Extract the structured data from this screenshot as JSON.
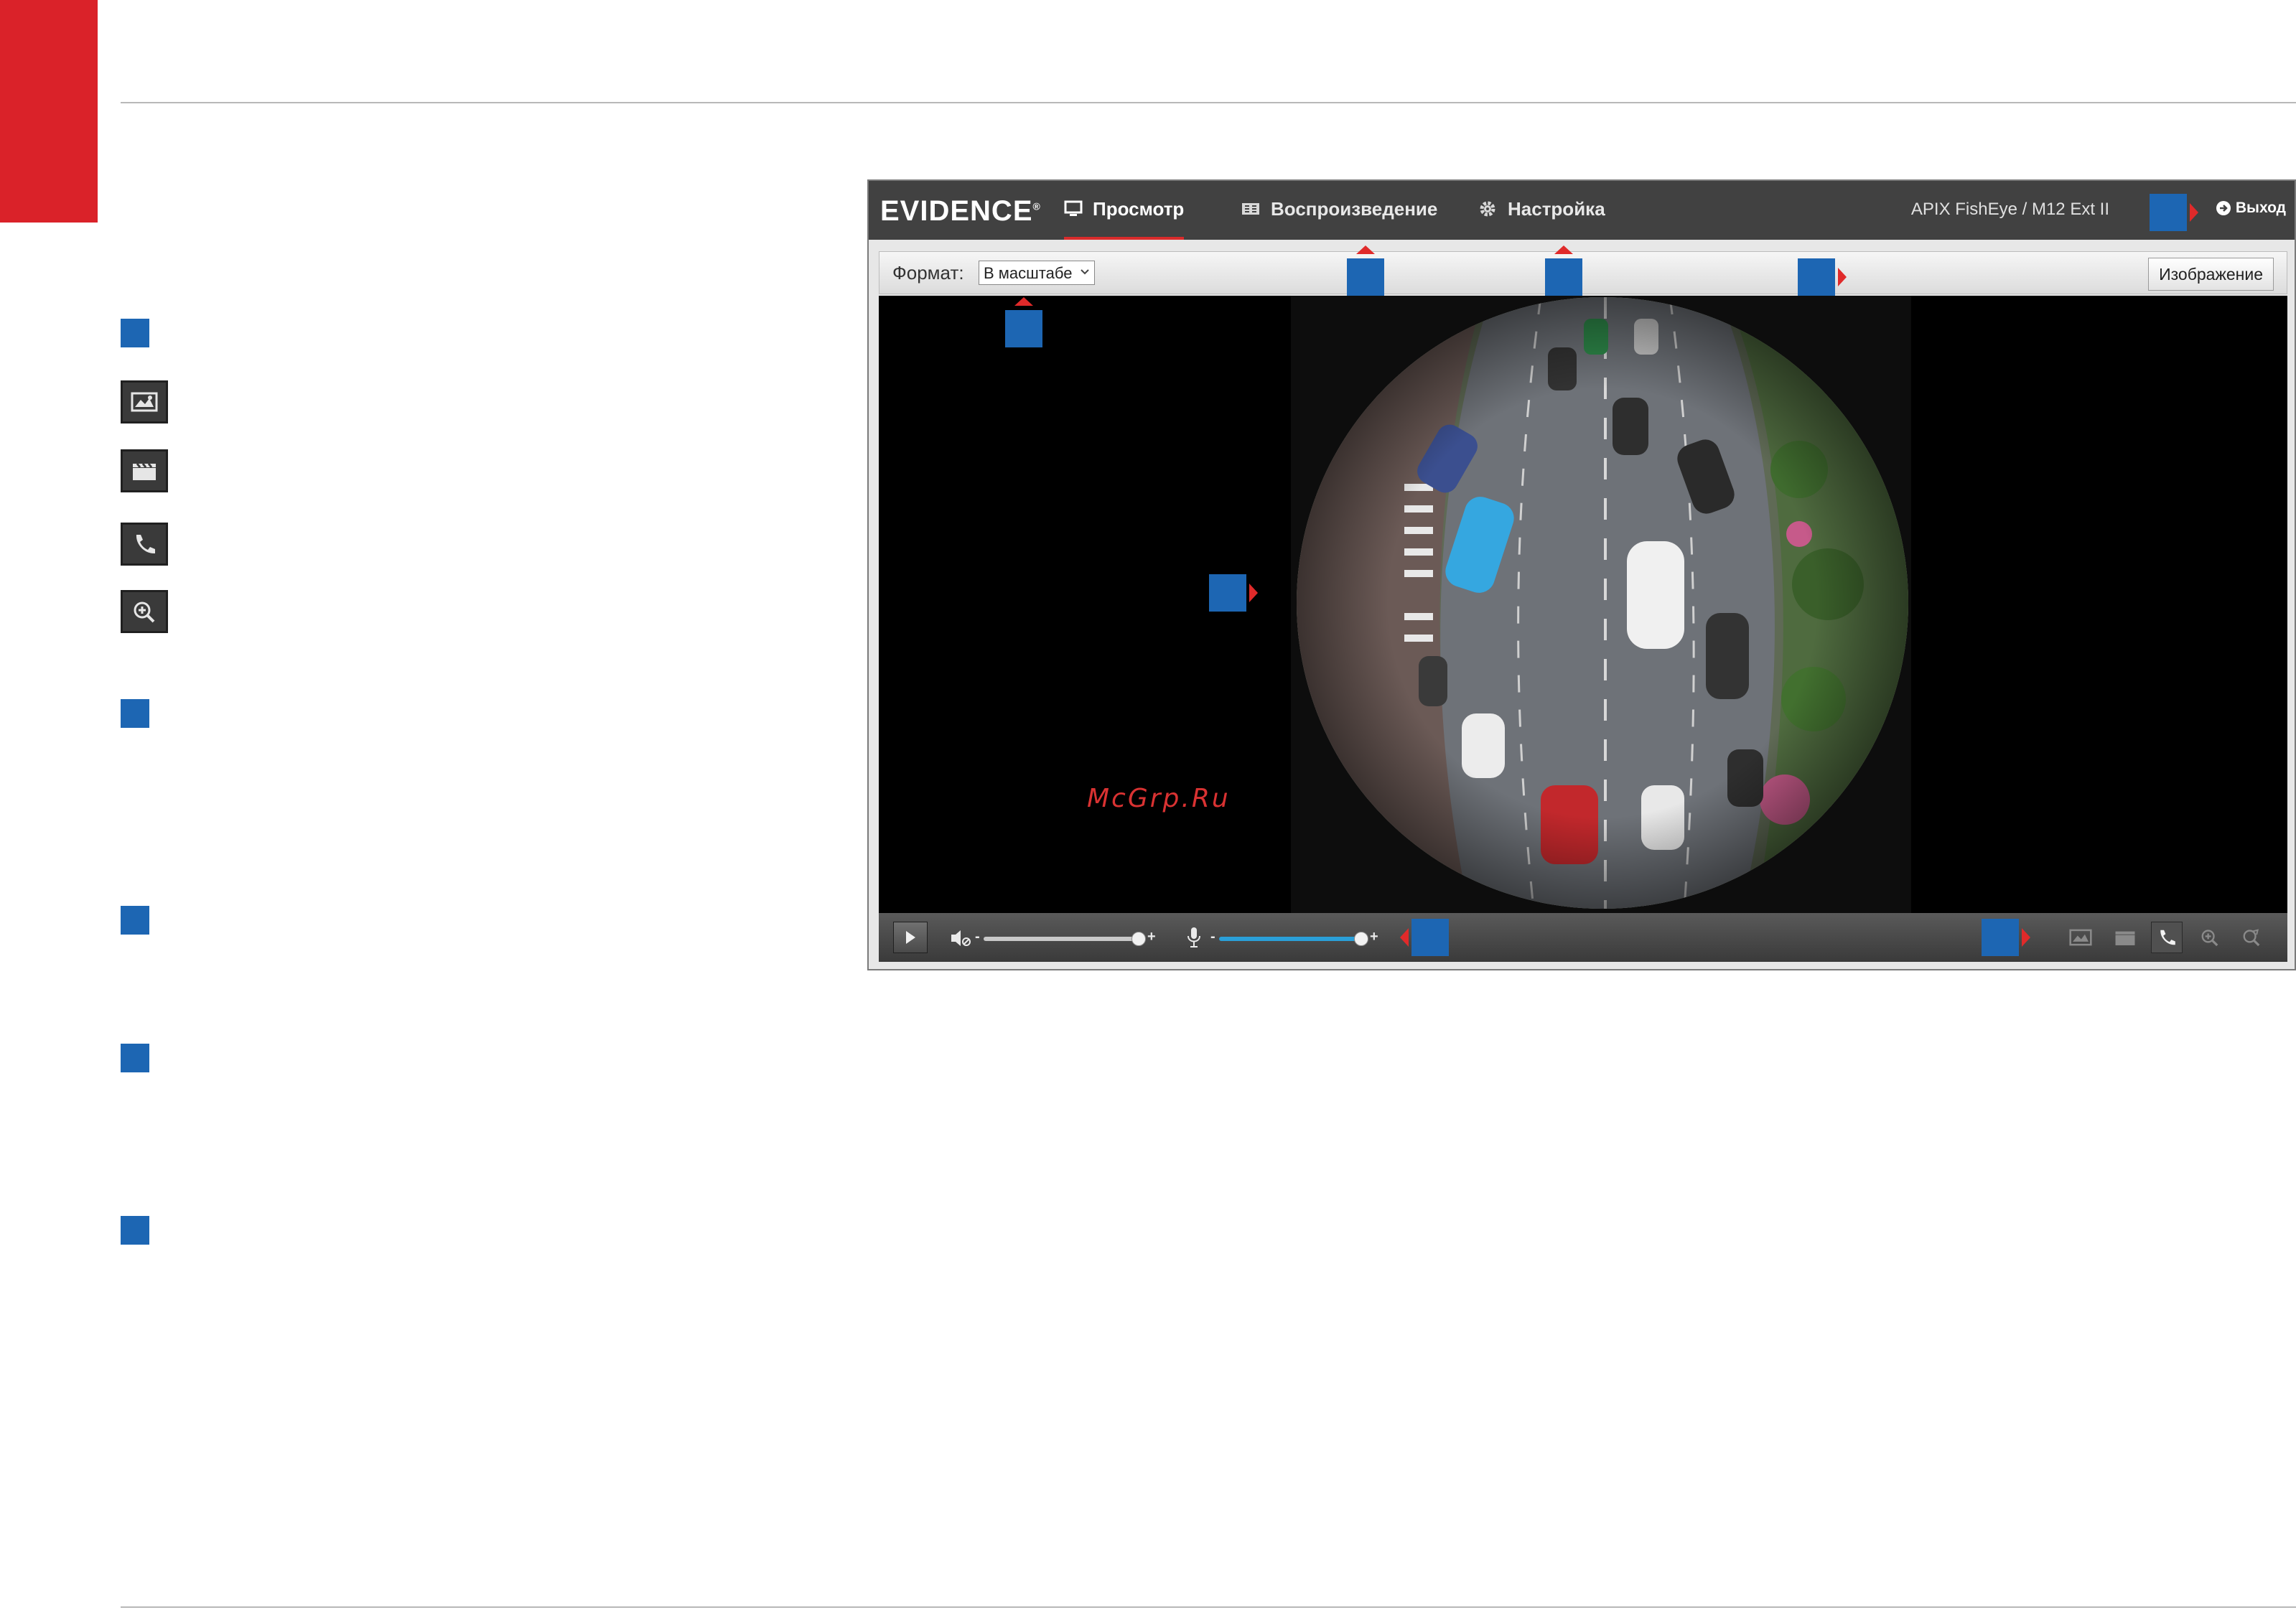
{
  "app": {
    "brand": "EVIDENCE",
    "brand_mark": "®",
    "nav": {
      "live": "Просмотр",
      "playback": "Воспроизведение",
      "settings": "Настройка"
    },
    "camera_model": "APIX FishEye / M12 Ext II",
    "logout": "Выход",
    "toolbar": {
      "format_label": "Формат:",
      "format_value": "В масштабе",
      "image_button": "Изображение"
    },
    "controls": {
      "minus": "-",
      "plus": "+"
    }
  },
  "watermark": "McGrp.Ru",
  "colors": {
    "accent_red": "#da2229",
    "callout_blue": "#1d66b3",
    "topbar": "#414141",
    "volume_slider": "#c8c8c8",
    "mic_slider": "#2a9fd8"
  },
  "icons": {
    "legend": [
      "picture-mode-icon",
      "record-clip-icon",
      "phone-talk-icon",
      "zoom-in-icon"
    ],
    "controls_right": [
      "picture-mode-icon",
      "record-clip-icon",
      "phone-talk-icon",
      "zoom-in-icon",
      "zoom-reset-icon"
    ]
  }
}
